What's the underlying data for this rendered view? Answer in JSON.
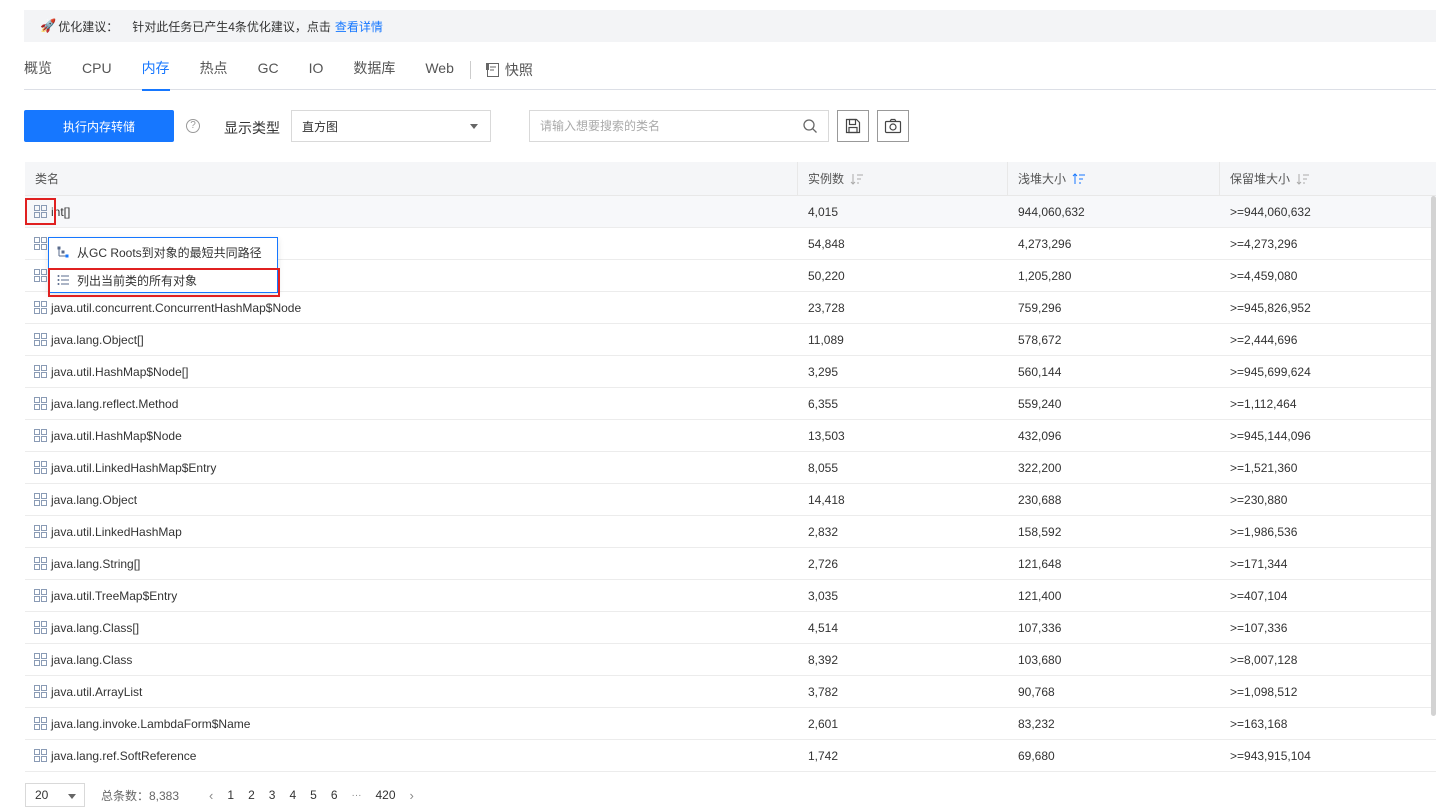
{
  "banner": {
    "label": "优化建议：",
    "text": "针对此任务已产生4条优化建议，点击",
    "link": "查看详情"
  },
  "tabs": [
    {
      "label": "概览"
    },
    {
      "label": "CPU"
    },
    {
      "label": "内存"
    },
    {
      "label": "热点"
    },
    {
      "label": "GC"
    },
    {
      "label": "IO"
    },
    {
      "label": "数据库"
    },
    {
      "label": "Web"
    }
  ],
  "snapshot_tab": "快照",
  "toolbar": {
    "dump_button": "执行内存转储",
    "display_type_label": "显示类型",
    "display_type_value": "直方图",
    "search_placeholder": "请输入想要搜索的类名"
  },
  "table": {
    "headers": {
      "class": "类名",
      "instances": "实例数",
      "shallow": "浅堆大小",
      "retained": "保留堆大小"
    },
    "rows": [
      {
        "name": "int[]",
        "instances": "4,015",
        "shallow": "944,060,632",
        "retained": ">=944,060,632"
      },
      {
        "name": "",
        "instances": "54,848",
        "shallow": "4,273,296",
        "retained": ">=4,273,296"
      },
      {
        "name": "",
        "instances": "50,220",
        "shallow": "1,205,280",
        "retained": ">=4,459,080"
      },
      {
        "name": "java.util.concurrent.ConcurrentHashMap$Node",
        "instances": "23,728",
        "shallow": "759,296",
        "retained": ">=945,826,952"
      },
      {
        "name": "java.lang.Object[]",
        "instances": "11,089",
        "shallow": "578,672",
        "retained": ">=2,444,696"
      },
      {
        "name": "java.util.HashMap$Node[]",
        "instances": "3,295",
        "shallow": "560,144",
        "retained": ">=945,699,624"
      },
      {
        "name": "java.lang.reflect.Method",
        "instances": "6,355",
        "shallow": "559,240",
        "retained": ">=1,112,464"
      },
      {
        "name": "java.util.HashMap$Node",
        "instances": "13,503",
        "shallow": "432,096",
        "retained": ">=945,144,096"
      },
      {
        "name": "java.util.LinkedHashMap$Entry",
        "instances": "8,055",
        "shallow": "322,200",
        "retained": ">=1,521,360"
      },
      {
        "name": "java.lang.Object",
        "instances": "14,418",
        "shallow": "230,688",
        "retained": ">=230,880"
      },
      {
        "name": "java.util.LinkedHashMap",
        "instances": "2,832",
        "shallow": "158,592",
        "retained": ">=1,986,536"
      },
      {
        "name": "java.lang.String[]",
        "instances": "2,726",
        "shallow": "121,648",
        "retained": ">=171,344"
      },
      {
        "name": "java.util.TreeMap$Entry",
        "instances": "3,035",
        "shallow": "121,400",
        "retained": ">=407,104"
      },
      {
        "name": "java.lang.Class[]",
        "instances": "4,514",
        "shallow": "107,336",
        "retained": ">=107,336"
      },
      {
        "name": "java.lang.Class",
        "instances": "8,392",
        "shallow": "103,680",
        "retained": ">=8,007,128"
      },
      {
        "name": "java.util.ArrayList",
        "instances": "3,782",
        "shallow": "90,768",
        "retained": ">=1,098,512"
      },
      {
        "name": "java.lang.invoke.LambdaForm$Name",
        "instances": "2,601",
        "shallow": "83,232",
        "retained": ">=163,168"
      },
      {
        "name": "java.lang.ref.SoftReference",
        "instances": "1,742",
        "shallow": "69,680",
        "retained": ">=943,915,104"
      }
    ]
  },
  "context_menu": {
    "items": [
      {
        "label": "从GC Roots到对象的最短共同路径",
        "icon": "tree-path-icon"
      },
      {
        "label": "列出当前类的所有对象",
        "icon": "list-icon"
      }
    ]
  },
  "footer": {
    "page_size": "20",
    "total_label": "总条数：8,383",
    "pages": [
      "1",
      "2",
      "3",
      "4",
      "5",
      "6"
    ],
    "ellipsis": "···",
    "last_page": "420"
  },
  "colors": {
    "accent": "#1677ff",
    "highlight": "#e02020"
  }
}
